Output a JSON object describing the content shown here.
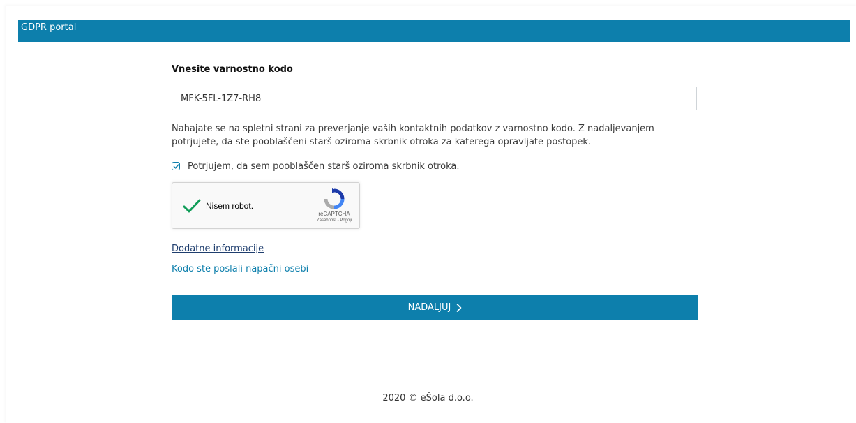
{
  "header": {
    "title": "GDPR portal"
  },
  "form": {
    "heading": "Vnesite varnostno kodo",
    "code_value": "MFK-5FL-1Z7-RH8",
    "info_text": "Nahajate se na spletni strani za preverjanje vaših kontaktnih podatkov z varnostno kodo. Z nadaljevanjem potrjujete, da ste pooblaščeni starš oziroma skrbnik otroka za katerega opravljate postopek.",
    "consent_label": "Potrjujem, da sem pooblaščen starš oziroma skrbnik otroka.",
    "consent_checked": true
  },
  "recaptcha": {
    "label": "Nisem robot.",
    "checked": true,
    "brand": "reCAPTCHA",
    "privacy_link": "Zasebnost",
    "separator": " - ",
    "terms_link": "Pogoji"
  },
  "links": {
    "more_info": "Dodatne informacije",
    "wrong_person": "Kodo ste poslali napačni osebi"
  },
  "continue_button": {
    "label": "NADALJUJ",
    "icon": "chevron-right-icon"
  },
  "footer": {
    "text": "2020 © eŠola d.o.o."
  },
  "colors": {
    "primary": "#0d7fac",
    "link_dark": "#1f3e6e",
    "check_green": "#109d58"
  }
}
